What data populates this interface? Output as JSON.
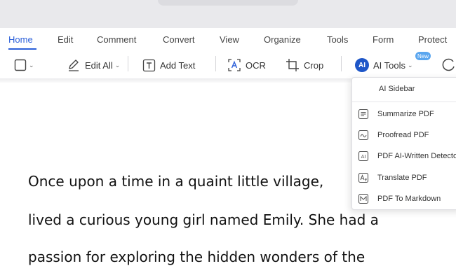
{
  "menu": {
    "items": [
      "Home",
      "Edit",
      "Comment",
      "Convert",
      "View",
      "Organize",
      "Tools",
      "Form",
      "Protect"
    ]
  },
  "toolbar": {
    "edit_all_label": "Edit All",
    "add_text_label": "Add Text",
    "ocr_label": "OCR",
    "crop_label": "Crop",
    "ai_badge_text": "AI",
    "ai_tools_label": "AI Tools",
    "new_badge_text": "New",
    "caret": "⌄"
  },
  "document": {
    "lines": [
      "Once upon a time in a quaint little village,",
      "lived a curious young girl named Emily. She had a",
      "passion for exploring the hidden wonders of the"
    ]
  },
  "ai_menu": {
    "header": "AI Sidebar",
    "items": [
      {
        "label": "Summarize PDF",
        "icon": "summarize-icon"
      },
      {
        "label": "Proofread PDF",
        "icon": "proofread-icon"
      },
      {
        "label": "PDF AI-Written Detector",
        "icon": "ai-detector-icon"
      },
      {
        "label": "Translate PDF",
        "icon": "translate-icon"
      },
      {
        "label": "PDF To Markdown",
        "icon": "markdown-icon"
      }
    ]
  },
  "colors": {
    "accent": "#2b5fd9",
    "ai_badge": "#1e56c8",
    "new_badge": "#5aa6ef"
  }
}
